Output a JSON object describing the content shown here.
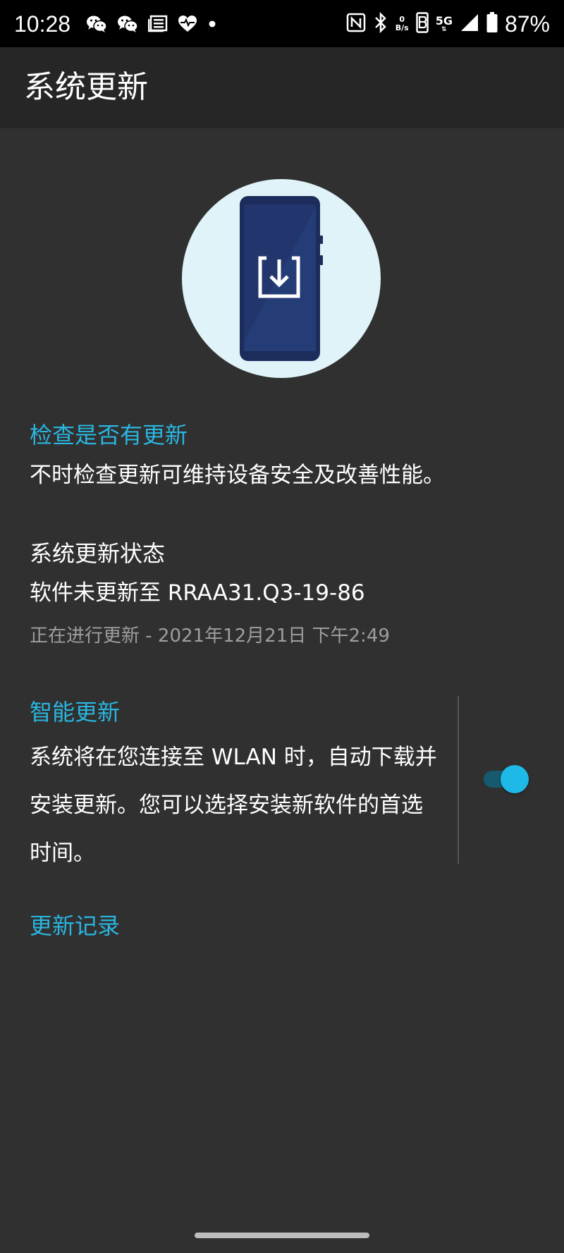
{
  "status_bar": {
    "time": "10:28",
    "left_icons": [
      "wechat-icon",
      "wechat-icon",
      "news-icon",
      "heart-pulse-icon",
      "dot-icon"
    ],
    "right_icons": [
      "nfc-icon",
      "bluetooth-icon",
      "net-speed",
      "volte-icon",
      "5g-icon",
      "signal-icon",
      "battery-icon"
    ],
    "net_speed_value": "0",
    "net_speed_unit": "B/s",
    "network_type": "5G",
    "battery": "87%"
  },
  "app_bar": {
    "title": "系统更新"
  },
  "check_update": {
    "title": "检查是否有更新",
    "description": "不时检查更新可维持设备安全及改善性能。"
  },
  "update_status": {
    "title": "系统更新状态",
    "version_text": "软件未更新至 RRAA31.Q3-19-86",
    "progress_text": "正在进行更新 - 2021年12月21日 下午2:49"
  },
  "smart_update": {
    "title": "智能更新",
    "description": "系统将在您连接至 WLAN 时，自动下载并安装更新。您可以选择安装新软件的首选时间。",
    "enabled": true
  },
  "update_history": {
    "label": "更新记录"
  },
  "colors": {
    "accent": "#29b6e0",
    "background": "#303030",
    "app_bar": "#262626",
    "status_bar": "#000000",
    "secondary_text": "#9e9e9e"
  }
}
